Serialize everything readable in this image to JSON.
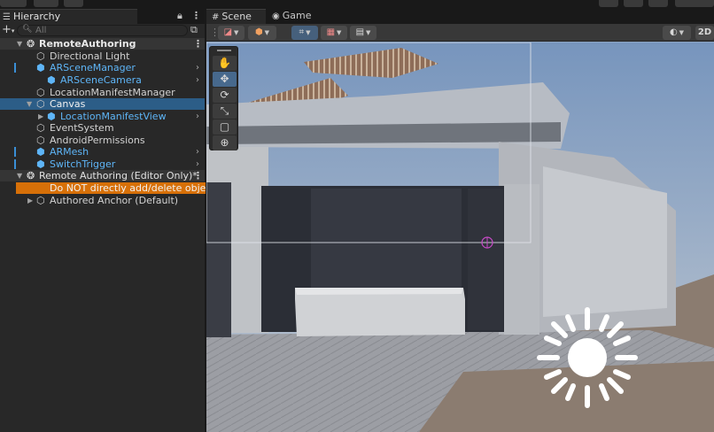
{
  "hierarchy": {
    "tab_label": "Hierarchy",
    "search_placeholder": "All",
    "rows": [
      {
        "label": "RemoteAuthoring",
        "kind": "scene-root",
        "icon": "unity-logo-icon",
        "expanded": true
      },
      {
        "label": "Directional Light",
        "kind": "object",
        "icon": "gameobject-cube-icon"
      },
      {
        "label": "ARSceneManager",
        "kind": "prefab",
        "icon": "prefab-cube-icon",
        "has_children": true
      },
      {
        "label": "ARSceneCamera",
        "kind": "prefab",
        "icon": "prefab-cube-icon",
        "has_children": true
      },
      {
        "label": "LocationManifestManager",
        "kind": "object",
        "icon": "gameobject-cube-icon"
      },
      {
        "label": "Canvas",
        "kind": "object",
        "icon": "gameobject-cube-icon",
        "selected": true,
        "expanded": true
      },
      {
        "label": "LocationManifestView",
        "kind": "prefab",
        "icon": "prefab-cube-icon",
        "has_children": true
      },
      {
        "label": "EventSystem",
        "kind": "object",
        "icon": "gameobject-cube-icon"
      },
      {
        "label": "AndroidPermissions",
        "kind": "object",
        "icon": "gameobject-cube-icon"
      },
      {
        "label": "ARMesh",
        "kind": "prefab",
        "icon": "prefab-cube-icon",
        "has_children": true
      },
      {
        "label": "SwitchTrigger",
        "kind": "prefab",
        "icon": "prefab-cube-icon",
        "has_children": true
      },
      {
        "label": "Remote Authoring (Editor Only)*",
        "kind": "scene-root",
        "icon": "unity-logo-icon",
        "expanded": true
      },
      {
        "label": "Do NOT directly add/delete objects to",
        "kind": "warning"
      },
      {
        "label": "Authored Anchor (Default)",
        "kind": "object",
        "icon": "gameobject-cube-icon",
        "collapsed": true
      }
    ]
  },
  "scene": {
    "tabs": [
      {
        "label": "Scene",
        "icon": "grid-icon",
        "active": true
      },
      {
        "label": "Game",
        "icon": "gamepad-icon",
        "active": false
      }
    ],
    "toolbar": {
      "mode_2d_label": "2D"
    },
    "tools": [
      {
        "name": "hand-tool",
        "glyph": "✋",
        "active": false
      },
      {
        "name": "move-tool",
        "glyph": "✥",
        "active": true
      },
      {
        "name": "rotate-tool",
        "glyph": "⟳",
        "active": false
      },
      {
        "name": "scale-tool",
        "glyph": "⤡",
        "active": false
      },
      {
        "name": "rect-tool",
        "glyph": "▢",
        "active": false
      },
      {
        "name": "transform-tool",
        "glyph": "⊕",
        "active": false
      }
    ]
  },
  "colors": {
    "selection": "#2c5d87",
    "warning": "#d77008",
    "prefab_text": "#5eb5f7"
  }
}
